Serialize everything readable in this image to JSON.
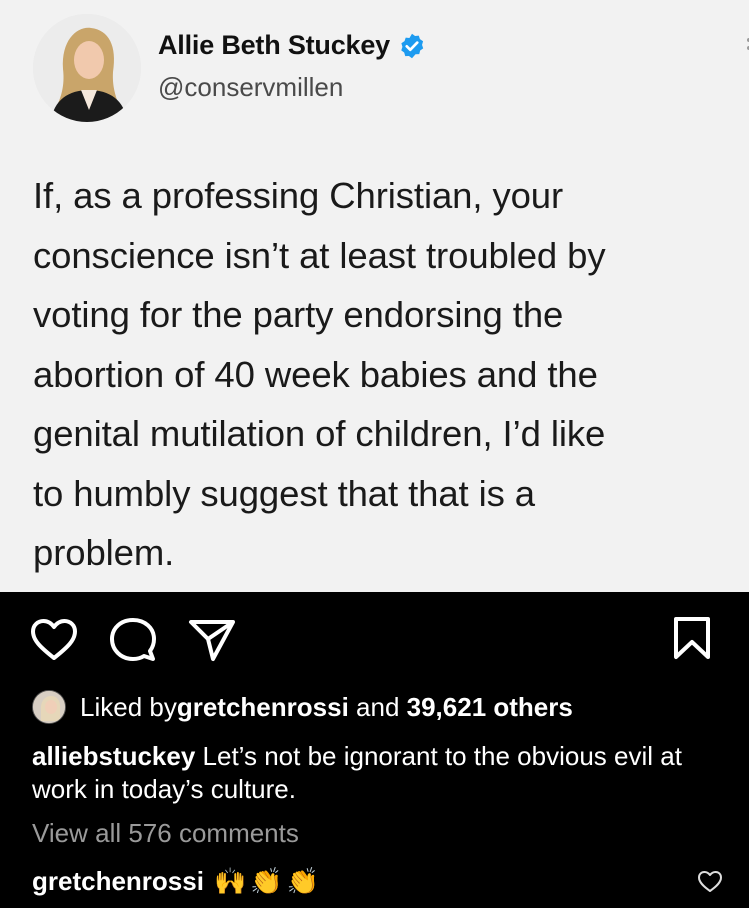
{
  "tweet": {
    "author_name": "Allie Beth Stuckey",
    "handle": "@conservmillen",
    "text_lines": [
      "If, as a professing Christian, your",
      "conscience isn’t at least troubled by",
      "voting for the party endorsing the",
      "abortion of 40 week babies and the",
      "genital mutilation of children, I’d like",
      "to humbly suggest that that is a",
      "problem."
    ]
  },
  "post": {
    "liked_prefix": "Liked by ",
    "liked_user": "gretchenrossi",
    "liked_and": " and ",
    "liked_others": "39,621 others",
    "caption_user": "alliebstuckey",
    "caption_text": " Let’s not be ignorant to the obvious evil at work in today’s culture.",
    "view_all_comments": "View all 576 comments",
    "comment_user": "gretchenrossi",
    "comment_emojis": [
      "🙌",
      "👏",
      "👏"
    ]
  },
  "colors": {
    "verified": "#1d9bf0",
    "tweet_bg": "#f2f2f2",
    "app_bg": "#000000",
    "muted": "#9a9a9a"
  },
  "icons": {
    "actions": [
      "heart-icon",
      "comment-icon",
      "share-icon",
      "bookmark-icon"
    ],
    "verified": "verified-badge-icon",
    "comment_like": "heart-outline-icon"
  }
}
